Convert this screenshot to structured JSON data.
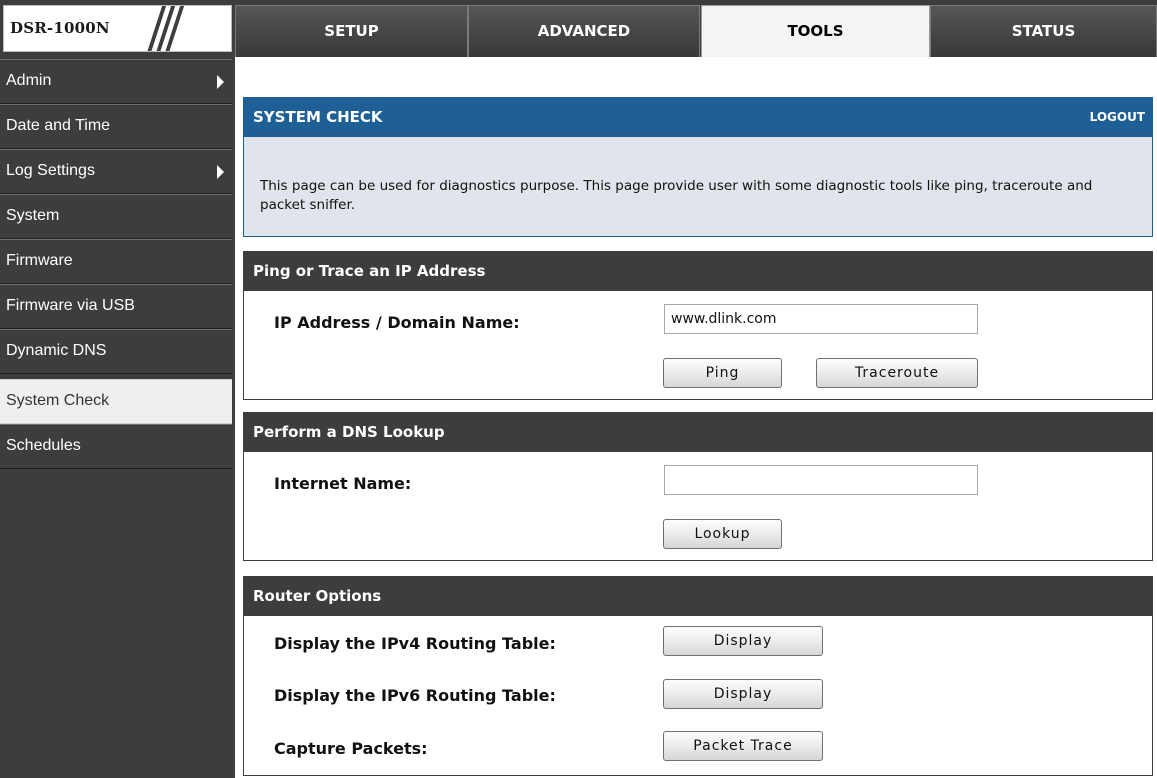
{
  "header": {
    "logo_text": "DSR-1000N",
    "tabs": [
      {
        "label": "SETUP"
      },
      {
        "label": "ADVANCED"
      },
      {
        "label": "TOOLS"
      },
      {
        "label": "STATUS"
      }
    ],
    "active_tab": "TOOLS"
  },
  "sidebar": {
    "items": [
      {
        "label": "Admin",
        "has_submenu": true
      },
      {
        "label": "Date and Time",
        "has_submenu": false
      },
      {
        "label": "Log Settings",
        "has_submenu": true
      },
      {
        "label": "System",
        "has_submenu": false
      },
      {
        "label": "Firmware",
        "has_submenu": false
      },
      {
        "label": "Firmware via USB",
        "has_submenu": false
      },
      {
        "label": "Dynamic DNS",
        "has_submenu": false
      },
      {
        "label": "System Check",
        "has_submenu": false
      },
      {
        "label": "Schedules",
        "has_submenu": false
      }
    ],
    "active_item": "System Check"
  },
  "page": {
    "title": "SYSTEM CHECK",
    "logout_label": "LOGOUT",
    "description": "This page can be used for diagnostics purpose. This page provide user with some diagnostic tools like ping, traceroute and packet sniffer."
  },
  "ping_section": {
    "title": "Ping or Trace an IP Address",
    "field_label": "IP Address / Domain Name:",
    "field_value": "www.dlink.com",
    "ping_label": "Ping",
    "traceroute_label": "Traceroute"
  },
  "dns_section": {
    "title": "Perform a DNS Lookup",
    "field_label": "Internet Name:",
    "field_value": "",
    "lookup_label": "Lookup"
  },
  "router_section": {
    "title": "Router Options",
    "ipv4_label": "Display the IPv4 Routing Table:",
    "ipv4_button": "Display",
    "ipv6_label": "Display the IPv6 Routing Table:",
    "ipv6_button": "Display",
    "capture_label": "Capture Packets:",
    "capture_button": "Packet Trace"
  },
  "colors": {
    "header_blue": "#1e5f95",
    "dark_bar": "#3d3d3d",
    "description_bg": "#dfe5ea"
  }
}
